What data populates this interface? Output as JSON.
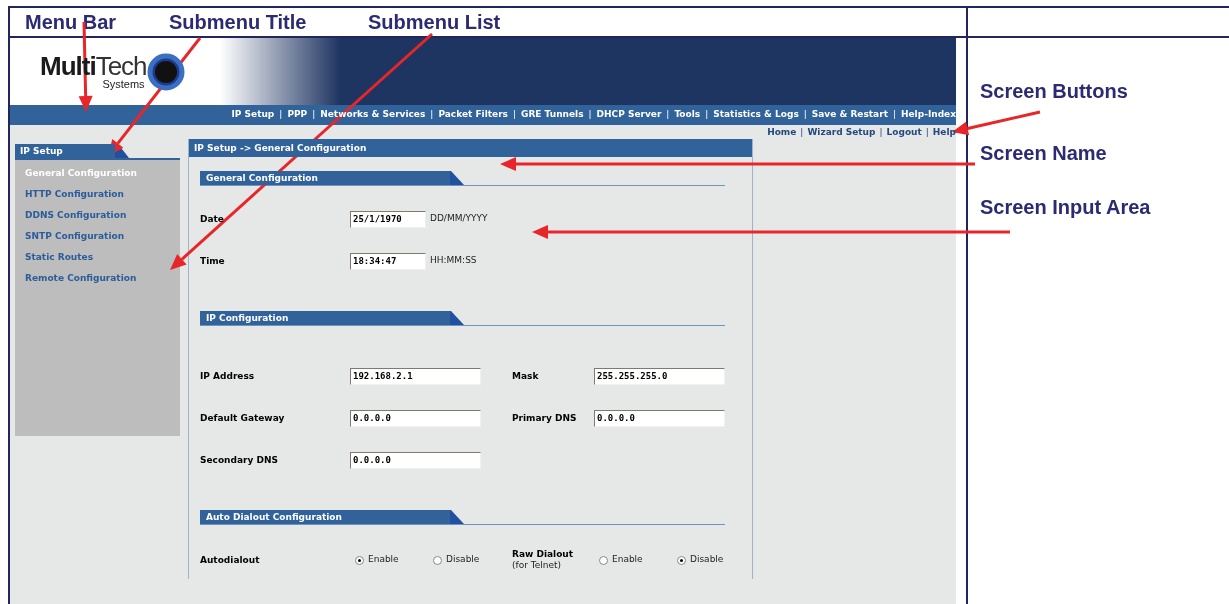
{
  "annotations": [
    {
      "kind": "top",
      "label": "Menu Bar"
    },
    {
      "kind": "top",
      "label": "Submenu Title"
    },
    {
      "kind": "top",
      "label": "Submenu List"
    },
    {
      "kind": "side",
      "label": "Screen Buttons"
    },
    {
      "kind": "side",
      "label": "Screen Name"
    },
    {
      "kind": "side",
      "label": "Screen Input Area"
    }
  ],
  "logo": {
    "bold": "Multi",
    "light": "Tech",
    "tagline": "Systems"
  },
  "menu_bar": [
    {
      "kind": "link",
      "label": "IP Setup"
    },
    {
      "kind": "separator",
      "label": "|"
    },
    {
      "kind": "link",
      "label": "PPP"
    },
    {
      "kind": "separator",
      "label": "|"
    },
    {
      "kind": "link",
      "label": "Networks & Services"
    },
    {
      "kind": "separator",
      "label": "|"
    },
    {
      "kind": "link",
      "label": "Packet Filters"
    },
    {
      "kind": "separator",
      "label": "|"
    },
    {
      "kind": "link",
      "label": "GRE Tunnels"
    },
    {
      "kind": "separator",
      "label": "|"
    },
    {
      "kind": "link",
      "label": "DHCP Server"
    },
    {
      "kind": "separator",
      "label": "|"
    },
    {
      "kind": "link",
      "label": "Tools"
    },
    {
      "kind": "separator",
      "label": "|"
    },
    {
      "kind": "link",
      "label": "Statistics & Logs"
    },
    {
      "kind": "separator",
      "label": "|"
    },
    {
      "kind": "link",
      "label": "Save & Restart"
    },
    {
      "kind": "separator",
      "label": "|"
    },
    {
      "kind": "link",
      "label": "Help-Index"
    }
  ],
  "screen_buttons": [
    {
      "kind": "link",
      "label": "Home"
    },
    {
      "kind": "separator",
      "label": "|"
    },
    {
      "kind": "link",
      "label": "Wizard Setup"
    },
    {
      "kind": "separator",
      "label": "|"
    },
    {
      "kind": "link",
      "label": "Logout"
    },
    {
      "kind": "separator",
      "label": "|"
    },
    {
      "kind": "link",
      "label": "Help"
    }
  ],
  "sidebar": {
    "title": "IP Setup",
    "items": [
      {
        "label": "General Configuration",
        "selected": true
      },
      {
        "label": "HTTP Configuration",
        "selected": false
      },
      {
        "label": "DDNS Configuration",
        "selected": false
      },
      {
        "label": "SNTP Configuration",
        "selected": false
      },
      {
        "label": "Static Routes",
        "selected": false
      },
      {
        "label": "Remote Configuration",
        "selected": false
      }
    ]
  },
  "screen_name": "IP Setup -> General Configuration",
  "sections": [
    {
      "title": "General Configuration",
      "rows": [
        [
          {
            "kind": "text",
            "label": "Date",
            "value": "25/1/1970",
            "hint": "DD/MM/YYYY"
          }
        ],
        [
          {
            "kind": "text",
            "label": "Time",
            "value": "18:34:47",
            "hint": "HH:MM:SS"
          }
        ]
      ]
    },
    {
      "title": "IP Configuration",
      "rows": [
        [
          {
            "kind": "text",
            "label": "IP Address",
            "value": "192.168.2.1"
          },
          {
            "kind": "text",
            "label": "Mask",
            "value": "255.255.255.0"
          }
        ],
        [
          {
            "kind": "text",
            "label": "Default Gateway",
            "value": "0.0.0.0"
          },
          {
            "kind": "text",
            "label": "Primary DNS",
            "value": "0.0.0.0"
          }
        ],
        [
          {
            "kind": "text",
            "label": "Secondary DNS",
            "value": "0.0.0.0"
          }
        ]
      ]
    },
    {
      "title": "Auto Dialout Configuration",
      "rows": [
        [
          {
            "kind": "radio",
            "label": "Autodialout",
            "options": [
              {
                "label": "Enable",
                "selected": true
              },
              {
                "label": "Disable",
                "selected": false
              }
            ]
          },
          {
            "kind": "radio",
            "label": "Raw Dialout",
            "sublabel": "(for Telnet)",
            "options": [
              {
                "label": "Enable",
                "selected": false
              },
              {
                "label": "Disable",
                "selected": true
              }
            ]
          }
        ]
      ]
    }
  ]
}
